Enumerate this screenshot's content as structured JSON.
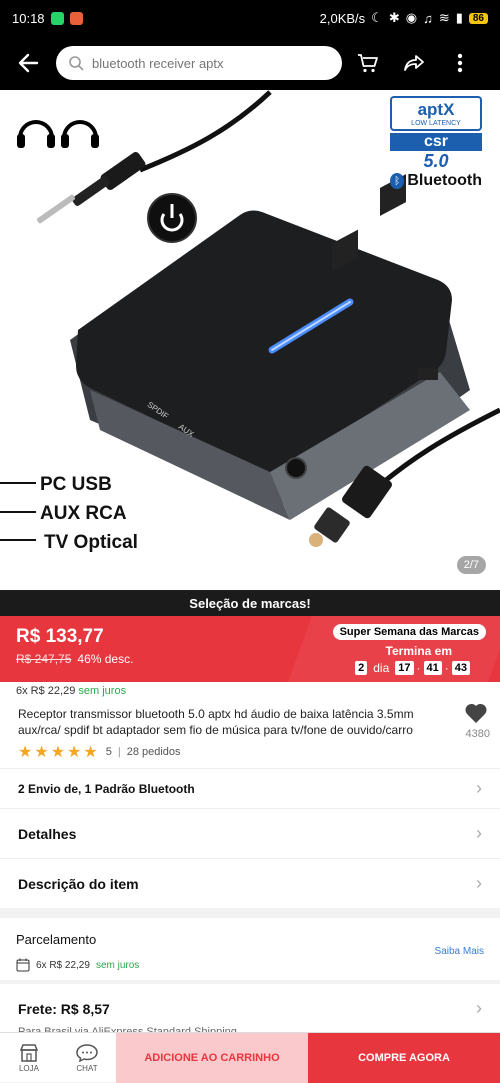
{
  "status_bar": {
    "time": "10:18",
    "network_speed": "2,0KB/s",
    "battery": "86"
  },
  "search": {
    "placeholder": "bluetooth receiver aptx"
  },
  "hero": {
    "pager": "2/7",
    "badge_aptx": "aptX",
    "badge_latency": "LOW LATENCY",
    "badge_csr": "csr",
    "badge_version": "5.0",
    "badge_bluetooth": "Bluetooth",
    "features": [
      "PC USB",
      "AUX RCA",
      "TV Optical"
    ],
    "device_labels": [
      "SPDIF",
      "AUX"
    ]
  },
  "brand_banner": "Seleção de marcas!",
  "price": {
    "current": "R$ 133,77",
    "original": "R$ 247,75",
    "discount": "46% desc.",
    "promo_name": "Super Semana das Marcas",
    "ends_label": "Termina em",
    "countdown": {
      "days": "2",
      "days_label": "dia",
      "hours": "17",
      "minutes": "41",
      "seconds": "43"
    }
  },
  "installments": {
    "text": "6x R$ 22,29",
    "tag": "sem juros"
  },
  "product": {
    "title": "Receptor transmissor bluetooth 5.0 aptx hd áudio de baixa latência 3.5mm aux/rca/ spdif bt adaptador sem fio de música para tv/fone de ouvido/carro",
    "rating": "5",
    "orders": "28 pedidos",
    "favorites": "4380"
  },
  "rows": {
    "variant": "2 Envio de, 1 Padrão Bluetooth",
    "details": "Detalhes",
    "description": "Descrição do item"
  },
  "parcelamento": {
    "title": "Parcelamento",
    "link": "Saiba Mais",
    "line": "6x R$ 22,29",
    "tag": "sem juros"
  },
  "shipping": {
    "title": "Frete: R$ 8,57",
    "subtitle": "Para Brasil via AliExpress Standard Shipping"
  },
  "bottom": {
    "store_label": "LOJA",
    "chat_label": "CHAT",
    "add_to_cart": "ADICIONE AO CARRINHO",
    "buy_now": "COMPRE AGORA"
  },
  "colors": {
    "accent": "#e8363f",
    "dark": "#000000",
    "star": "#f5a623",
    "link": "#3b7bd4"
  }
}
